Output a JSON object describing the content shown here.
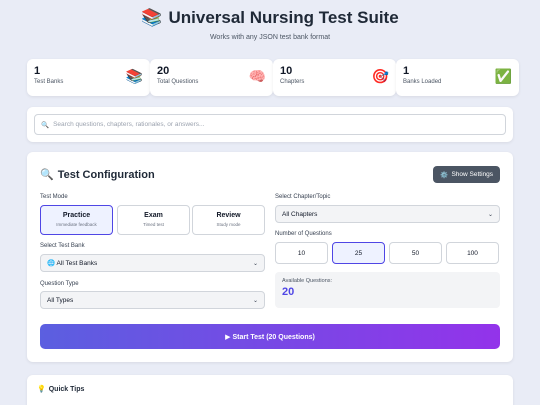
{
  "header": {
    "icon": "books-icon",
    "title": "Universal Nursing Test Suite",
    "subtitle": "Works with any JSON test bank format"
  },
  "stats": [
    {
      "value": "1",
      "label": "Test Banks",
      "icon": "books-icon"
    },
    {
      "value": "20",
      "label": "Total Questions",
      "icon": "brain-icon"
    },
    {
      "value": "10",
      "label": "Chapters",
      "icon": "target-icon"
    },
    {
      "value": "1",
      "label": "Banks Loaded",
      "icon": "check-icon"
    }
  ],
  "search": {
    "placeholder": "Search questions, chapters, rationales, or answers..."
  },
  "config": {
    "title": "Test Configuration",
    "settings_label": "Show Settings",
    "test_mode_label": "Test Mode",
    "modes": [
      {
        "title": "Practice",
        "sub": "Immediate feedback"
      },
      {
        "title": "Exam",
        "sub": "Timed test"
      },
      {
        "title": "Review",
        "sub": "Study mode"
      }
    ],
    "active_mode": "Practice",
    "bank_label": "Select Test Bank",
    "bank_value": "🌐 All Test Banks",
    "type_label": "Question Type",
    "type_value": "All Types",
    "chapter_label": "Select Chapter/Topic",
    "chapter_value": "All Chapters",
    "num_label": "Number of Questions",
    "num_options": [
      "10",
      "25",
      "50",
      "100"
    ],
    "num_selected": "25",
    "available_label": "Available Questions:",
    "available_value": "20",
    "start_label": "▶ Start Test (20 Questions)"
  },
  "tips": {
    "title": "Quick Tips"
  },
  "colors": {
    "accent": "#4f46e5",
    "gradient_end": "#9333ea",
    "settings_bg": "#4b5563"
  }
}
